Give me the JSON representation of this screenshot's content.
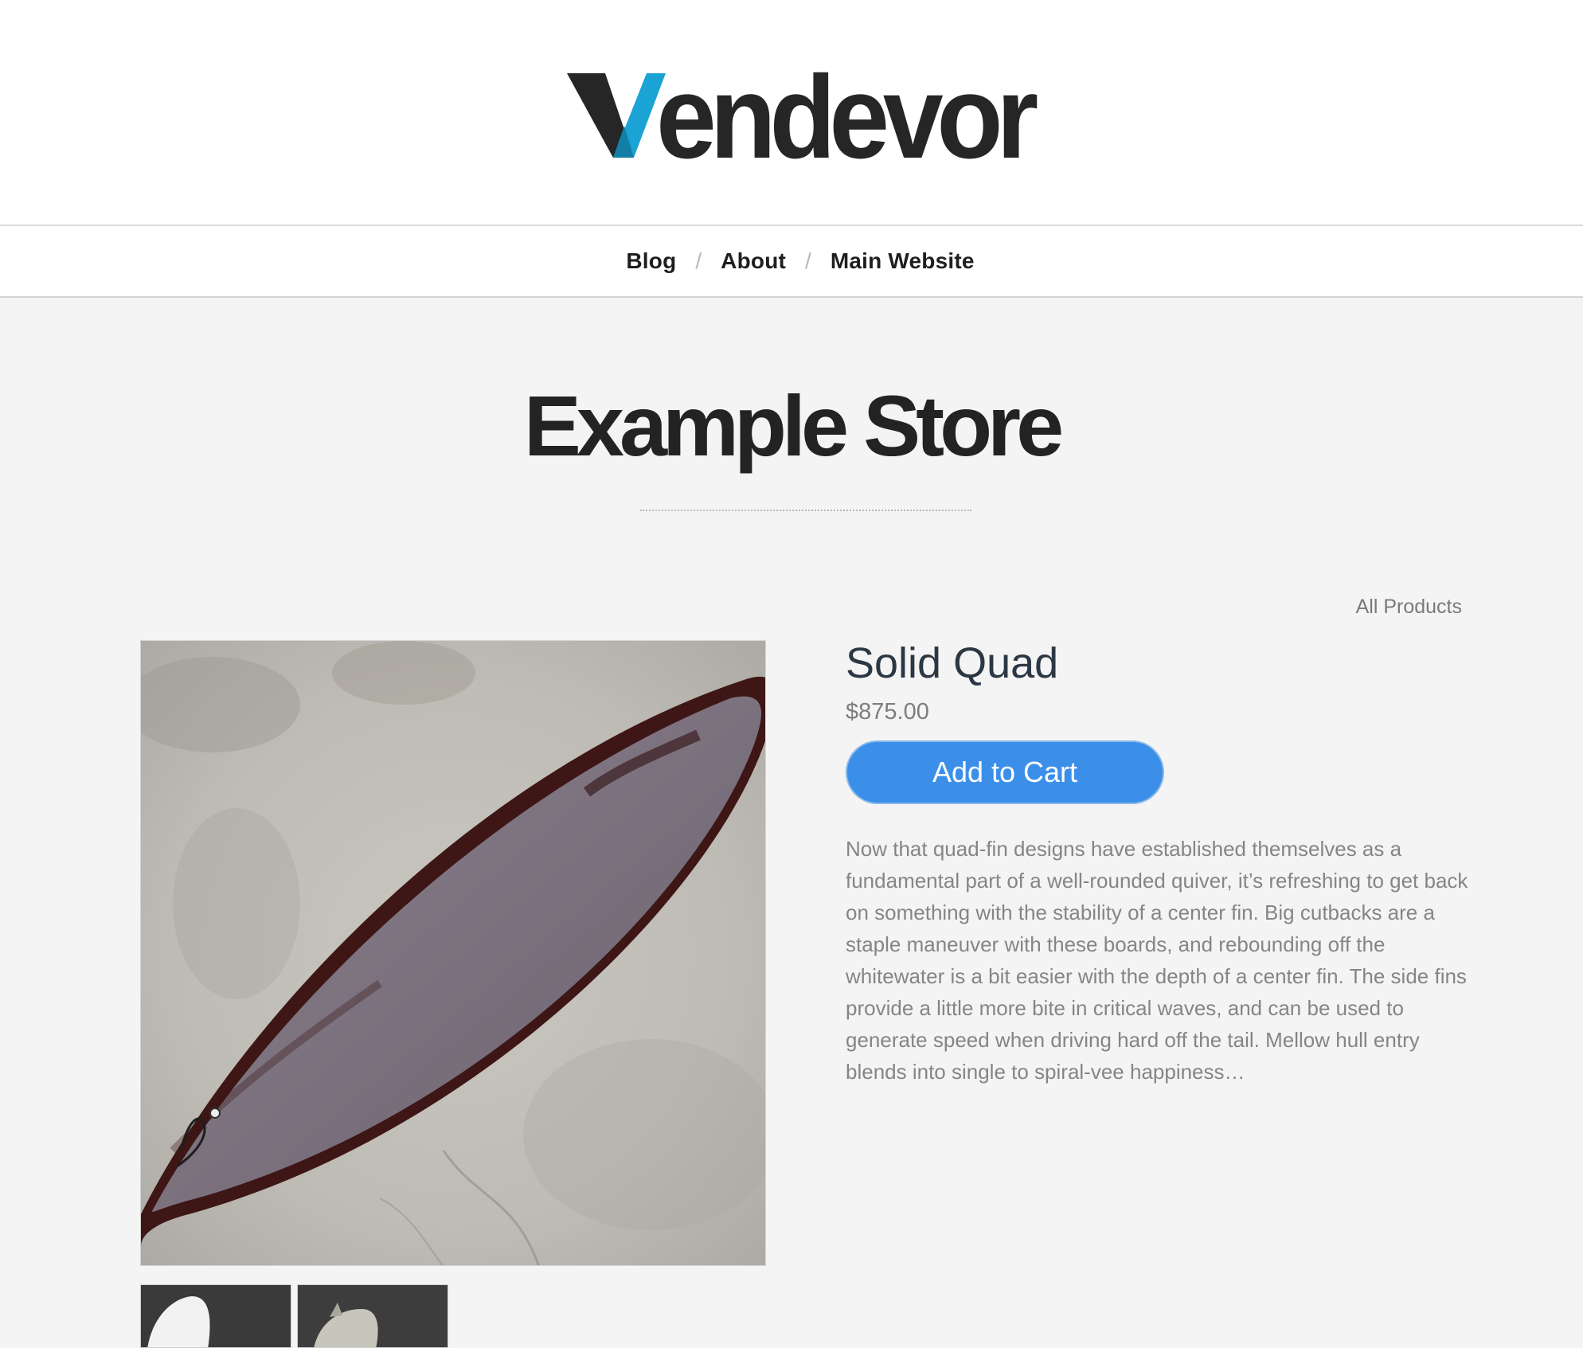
{
  "header": {
    "logo_text": "Vendevor",
    "accent_color": "#1aa3d4"
  },
  "nav": {
    "items": [
      {
        "label": "Blog"
      },
      {
        "label": "About"
      },
      {
        "label": "Main Website"
      }
    ],
    "separator": "/"
  },
  "store": {
    "title": "Example Store",
    "all_products_label": "All Products"
  },
  "product": {
    "name": "Solid Quad",
    "price": "$875.00",
    "add_to_cart_label": "Add to Cart",
    "button_color": "#3b8fe9",
    "description": "Now that quad-fin designs have established themselves as a fundamental part of a well-rounded quiver, it’s refreshing to get back on something with the stability of a center fin. Big cutbacks are a staple maneuver with these boards, and rebounding off the whitewater is a bit easier with the depth of a center fin. The side fins provide a little more bite in critical waves, and can be used to generate speed when driving hard off the tail. Mellow hull entry blends into single to spiral-vee happiness…"
  }
}
